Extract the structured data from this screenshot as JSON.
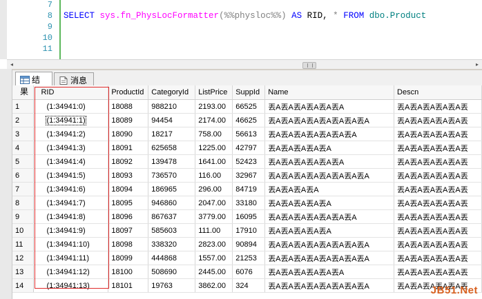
{
  "editor": {
    "line_numbers": [
      "7",
      "8",
      "9",
      "10",
      "11"
    ],
    "code": {
      "select": "SELECT",
      "func": "sys.fn_PhysLocFormatter",
      "args": "(%%physloc%%)",
      "as": "AS",
      "alias": "RID,",
      "star": "*",
      "from": "FROM",
      "table": "dbo.Product"
    }
  },
  "tabs": [
    {
      "label": "结果",
      "icon": "grid-icon"
    },
    {
      "label": "消息",
      "icon": "messages-icon"
    }
  ],
  "grid": {
    "columns": [
      "RID",
      "ProductId",
      "CategoryId",
      "ListPrice",
      "SuppId",
      "Name",
      "Descn"
    ],
    "rows": [
      [
        "1",
        "(1:34941:0)",
        "18088",
        "988210",
        "2193.00",
        "66525",
        "丟A丟A丟A丟A丟A丟A",
        "丟A丟A丟A丟A丟A丟"
      ],
      [
        "2",
        "(1:34941:1)",
        "18089",
        "94454",
        "2174.00",
        "46625",
        "丟A丟A丟A丟A丟A丟A丟A丟A",
        "丟A丟A丟A丟A丟A丟"
      ],
      [
        "3",
        "(1:34941:2)",
        "18090",
        "18217",
        "758.00",
        "56613",
        "丟A丟A丟A丟A丟A丟A丟A",
        "丟A丟A丟A丟A丟A丟"
      ],
      [
        "4",
        "(1:34941:3)",
        "18091",
        "625658",
        "1225.00",
        "42797",
        "丟A丟A丟A丟A丟A",
        "丟A丟A丟A丟A丟A丟"
      ],
      [
        "5",
        "(1:34941:4)",
        "18092",
        "139478",
        "1641.00",
        "52423",
        "丟A丟A丟A丟A丟A丟A",
        "丟A丟A丟A丟A丟A丟"
      ],
      [
        "6",
        "(1:34941:5)",
        "18093",
        "736570",
        "116.00",
        "32967",
        "丟A丟A丟A丟A丟A丟A丟A丟A",
        "丟A丟A丟A丟A丟A丟"
      ],
      [
        "7",
        "(1:34941:6)",
        "18094",
        "186965",
        "296.00",
        "84719",
        "丟A丟A丟A丟A",
        "丟A丟A丟A丟A丟A丟"
      ],
      [
        "8",
        "(1:34941:7)",
        "18095",
        "946860",
        "2047.00",
        "33180",
        "丟A丟A丟A丟A丟A",
        "丟A丟A丟A丟A丟A丟"
      ],
      [
        "9",
        "(1:34941:8)",
        "18096",
        "867637",
        "3779.00",
        "16095",
        "丟A丟A丟A丟A丟A丟A丟A",
        "丟A丟A丟A丟A丟A丟"
      ],
      [
        "10",
        "(1:34941:9)",
        "18097",
        "585603",
        "111.00",
        "17910",
        "丟A丟A丟A丟A丟A",
        "丟A丟A丟A丟A丟A丟"
      ],
      [
        "11",
        "(1:34941:10)",
        "18098",
        "338320",
        "2823.00",
        "90894",
        "丟A丟A丟A丟A丟A丟A丟A丟A",
        "丟A丟A丟A丟A丟A丟"
      ],
      [
        "12",
        "(1:34941:11)",
        "18099",
        "444868",
        "1557.00",
        "21253",
        "丟A丟A丟A丟A丟A丟A丟A丟A",
        "丟A丟A丟A丟A丟A丟"
      ],
      [
        "13",
        "(1:34941:12)",
        "18100",
        "508690",
        "2445.00",
        "6076",
        "丟A丟A丟A丟A丟A丟A",
        "丟A丟A丟A丟A丟A丟"
      ],
      [
        "14",
        "(1:34941:13)",
        "18101",
        "19763",
        "3862.00",
        "324",
        "丟A丟A丟A丟A丟A丟A丟A丟A",
        "丟A丟A丟A丟A丟A丟"
      ]
    ],
    "selected_row_index": 1
  },
  "colors": {
    "keyword": "#0000ff",
    "function": "#ff00ff",
    "annotation_box": "#e02a2a"
  },
  "watermark": "JB51.Net"
}
